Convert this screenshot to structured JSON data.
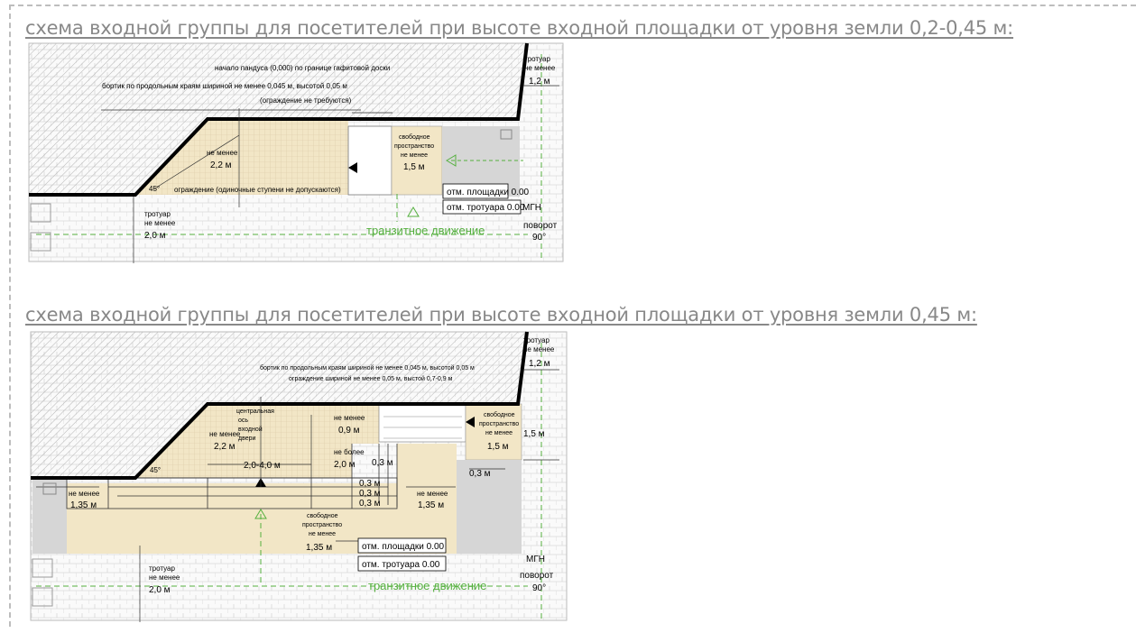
{
  "colors": {
    "heading": "#888888",
    "ramp_fill": "#f2e6c6",
    "green": "#55b03f",
    "gray_paving": "#d6d6d6",
    "wall": "#000000"
  },
  "heading_1": "схема входной группы для посетителей при высоте входной площадки от уровня земли 0,2-0,45 м:",
  "heading_2": "схема входной группы для посетителей при высоте входной площадки от уровня земли 0,45 м:",
  "scheme_1": {
    "ramp_start": "начало пандуса (0,000) по границе гафитовой доски",
    "curb": "бортик по продольным краям шириной не менее 0,045 м, высотой 0,05 м",
    "fence_note": "(ограждение не требуются)",
    "sidewalk_right_1": "тротуар",
    "sidewalk_right_2": "не менее",
    "sidewalk_right_3": "1,2 м",
    "ramp_1": "не менее",
    "ramp_2": "2,2 м",
    "free_1": "свободное",
    "free_2": "пространство",
    "free_3": "не менее",
    "free_4": "1,5 м",
    "angle": "45°",
    "fence": "ограждение (одиночные ступени не допускаются)",
    "level_platform": "отм. площадки 0.00",
    "level_sidewalk": "отм. тротуара 0.00",
    "mgn": "МГН",
    "sidewalk_left_1": "тротуар",
    "sidewalk_left_2": "не менее",
    "sidewalk_left_3": "2,0 м",
    "transit": "транзитное движение",
    "turn_1": "поворот",
    "turn_2": "90°"
  },
  "scheme_2": {
    "sidewalk_right_1": "тротуар",
    "sidewalk_right_2": "не менее",
    "sidewalk_right_3": "1,2 м",
    "curb": "бортик по продольным краям шириной не менее 0,045 м, высотой 0,05 м",
    "fence": "ограждение шириной не менее 0,05 м, выстой 0,7-0,9 м",
    "axis_1": "центральная",
    "axis_2": "ось",
    "axis_3": "входной",
    "axis_4": "двери",
    "ramp_1": "не менее",
    "ramp_2": "2,2 м",
    "door_width": "2,0-4,0 м",
    "upper_1": "не менее",
    "upper_2": "0,9 м",
    "max_1": "не более",
    "max_2": "2,0 м",
    "step_a": "0,3 м",
    "step_b": "0,3 м",
    "step_c": "0,3 м",
    "step_d": "0,3 м",
    "free_1": "свободное",
    "free_2": "пространство",
    "free_3": "не менее",
    "free_4": "1,5 м",
    "depth": "1,5 м",
    "offset": "0,3 м",
    "angle": "45°",
    "left_1": "не менее",
    "left_2": "1,35 м",
    "right_1": "не менее",
    "right_2": "1,35 м",
    "bottom_1": "свободное",
    "bottom_2": "пространство",
    "bottom_3": "не менее",
    "bottom_4": "1,35 м",
    "level_platform": "отм. площадки 0.00",
    "level_sidewalk": "отм. тротуара 0.00",
    "mgn": "МГН",
    "turn_1": "поворот",
    "turn_2": "90°",
    "sidewalk_left_1": "тротуар",
    "sidewalk_left_2": "не менее",
    "sidewalk_left_3": "2,0 м",
    "transit": "транзитное движение"
  }
}
